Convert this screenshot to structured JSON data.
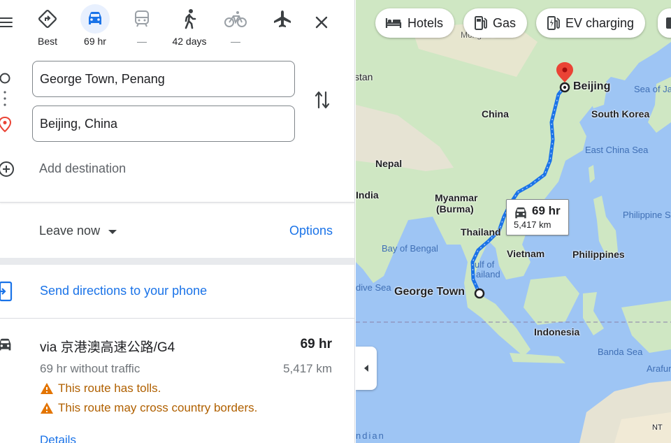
{
  "panel": {
    "modes": [
      {
        "label": "Best"
      },
      {
        "label": "69 hr"
      },
      {
        "label": "—"
      },
      {
        "label": "42 days"
      },
      {
        "label": "—"
      }
    ],
    "origin_value": "George Town, Penang",
    "destination_value": "Beijing, China",
    "add_destination": "Add destination",
    "leave_now": "Leave now",
    "options": "Options",
    "send_directions": "Send directions to your phone",
    "route": {
      "name": "via 京港澳高速公路/G4",
      "time": "69 hr",
      "without_traffic": "69 hr without traffic",
      "distance": "5,417 km",
      "warnings": [
        "This route has tolls.",
        "This route may cross country borders."
      ],
      "details_link": "Details"
    }
  },
  "map": {
    "chips": [
      {
        "label": "Hotels",
        "icon": "bed-icon"
      },
      {
        "label": "Gas",
        "icon": "gas-pump-icon"
      },
      {
        "label": "EV charging",
        "icon": "ev-charging-icon"
      }
    ],
    "route_box": {
      "time": "69 hr",
      "distance": "5,417 km"
    },
    "labels": {
      "beijing": "Beijing",
      "george_town": "George Town",
      "china": "China",
      "south_korea": "South Korea",
      "sea_of_ja": "Sea of Ja",
      "east_china_sea": "East China Sea",
      "nepal": "Nepal",
      "india": "India",
      "myanmar": "Myanmar",
      "burma": "(Burma)",
      "thailand": "Thailand",
      "vietnam": "Vietnam",
      "philippines": "Philippines",
      "philippine_s": "Philippine S",
      "bay_of_bengal": "Bay of Bengal",
      "gulf_of": "ulf of",
      "gulf_thailand": "ailand",
      "indonesia": "Indonesia",
      "banda_sea": "Banda Sea",
      "arafura": "Arafur",
      "nt": "NT",
      "ive_sea": "dive Sea",
      "indian": "ndian",
      "stan": "stan",
      "mongolia": "Mongolia"
    },
    "colors": {
      "route": "#1a73e8",
      "pin": "#ea4335",
      "land": "#cfe7c3",
      "water": "#9ec5f4"
    }
  }
}
